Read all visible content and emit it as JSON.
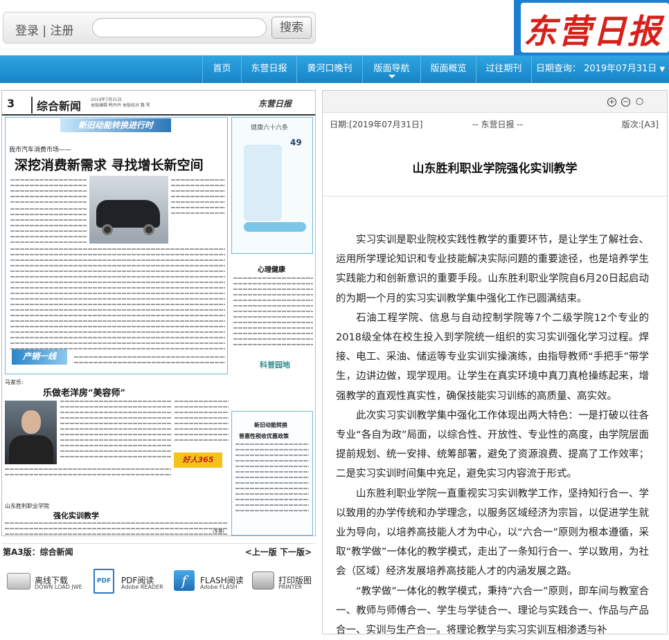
{
  "header": {
    "login_label": "登录",
    "separator": "|",
    "register_label": "注册",
    "search_placeholder": "",
    "search_button": "搜索",
    "logo_text": "东营日报"
  },
  "nav": {
    "items": [
      "首页",
      "东营日报",
      "黄河口晚刊",
      "版面导航",
      "版面概览",
      "过往期刊"
    ],
    "active": "版面导航",
    "date_label": "日期查询：",
    "date_value": "2019年07月31日"
  },
  "page_thumb": {
    "page_number": "3",
    "section": "综合新闻",
    "meta_line1": "2019年7月31日",
    "meta_line2": "本版编辑 韩丹丹 本版校对 魏 琴",
    "brand": "东营日报",
    "story1_kicker": "我市汽车消费市场——",
    "story1_headline": "深挖消费新需求  寻找增长新空间",
    "banner1": "新旧动能转换进行时",
    "column_title": "健康六十六条",
    "column_item": "49",
    "psych_title": "心理健康",
    "science_title": "科普园地",
    "story2_kicker": "马家乐:",
    "story2_headline": "乐做老洋房“美容师”",
    "tax_box_title": "新旧动能转换",
    "tax_box_subtitle": "普惠性税收优惠政策",
    "story3_kicker": "山东胜利职业学院",
    "story3_headline": "强化实训教学",
    "ad_text": "好人365",
    "caption": "(东营)"
  },
  "page_nav": {
    "current": "第A3版：综合新闻",
    "prev": "<上一版",
    "next": "下一版>"
  },
  "downloads": [
    {
      "title": "离线下载",
      "subtitle": "DOWN LOAD JWE",
      "icon": "download-icon"
    },
    {
      "title": "PDF阅读",
      "subtitle": "Adobe READER",
      "icon": "pdf-icon"
    },
    {
      "title": "FLASH阅读",
      "subtitle": "Adobe FLASH",
      "icon": "flash-icon"
    },
    {
      "title": "打印版图",
      "subtitle": "PRINTER",
      "icon": "printer-icon"
    }
  ],
  "article": {
    "zoom_in": "+",
    "zoom_out": "−",
    "reset": "○",
    "date": "日期:[2019年07月31日]",
    "source": "-- 东营日报 --",
    "edition": "版次:[A3]",
    "title": "山东胜利职业学院强化实训教学",
    "paragraphs": [
      "实习实训是职业院校实践性教学的重要环节，是让学生了解社会、运用所学理论知识和专业技能解决实际问题的重要途径，也是培养学生实践能力和创新意识的重要手段。山东胜利职业学院自6月20日起启动的为期一个月的实习实训教学集中强化工作已圆满结束。",
      "石油工程学院、信息与自动控制学院等7个二级学院12个专业的2018级全体在校生投入到学院统一组织的实习实训强化学习过程。焊接、电工、采油、储运等专业实训实操演练，由指导教师“手把手”带学生，边讲边做，现学现用。让学生在真实环境中真刀真枪操练起来，增强教学的直观性真实性，确保技能实习训练的高质量、高实效。",
      "此次实习实训教学集中强化工作体现出两大特色：一是打破以往各专业“各自为政”局面，以综合性、开放性、专业性的高度，由学院层面提前规划、统一安排、统筹部署，避免了资源浪费、提高了工作效率；二是实习实训时间集中充足，避免实习内容流于形式。",
      "山东胜利职业学院一直重视实习实训教学工作，坚持知行合一、学以致用的办学传统和办学理念，以服务区域经济为宗旨，以促进学生就业为导向，以培养高技能人才为中心，以“六合一”原则为根本遵循，采取“教学做”一体化的教学模式，走出了一条知行合一、学以致用，为社会（区域）经济发展培养高技能人才的内涵发展之路。",
      "“教学做”一体化的教学模式，秉持“六合一”原则，即车间与教室合一、教师与师傅合一、学生与学徒合一、理论与实践合一、作品与产品合一、实训与生产合一。将理论教学与实习实训互相渗透与补"
    ]
  },
  "colors": {
    "nav_blue": "#1a8bd0",
    "logo_red": "#d8201b",
    "banner_blue": "#2c77b8"
  }
}
